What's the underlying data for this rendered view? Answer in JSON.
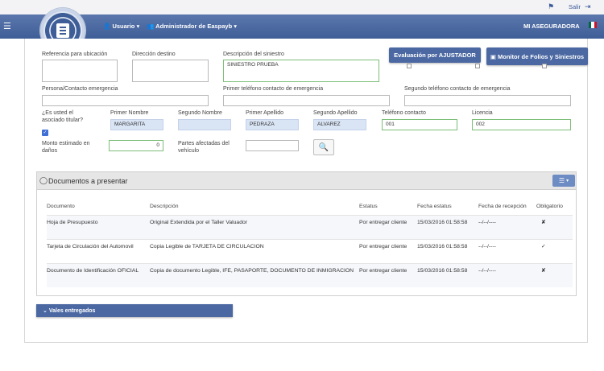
{
  "topbar": {
    "help_icon": "signpost-icon",
    "salir": "Salir",
    "logout_icon": "sign-out-icon"
  },
  "navbar": {
    "menu_icon": "hamburger-menu-icon",
    "usuario": "Usuario",
    "administrador": "Administrador de Easpayb",
    "aseguradora": "MI ASEGURADORA",
    "flag_colors": [
      "#006847",
      "#ffffff",
      "#ce1126"
    ]
  },
  "form": {
    "referencia_label": "Referencia para ubicación",
    "direccion_label": "Dirección destino",
    "descripcion_label": "Descripción del siniestro",
    "descripcion_value": "SINIESTRO PRUEBA",
    "btn_evaluacion": "Evaluación por AJUSTADOR",
    "btn_monitor": "Monitor de Folios y Siniestros",
    "persona_label": "Persona/Contacto emergencia",
    "primer_tel_label": "Primer teléfono contacto de emergencia",
    "segundo_tel_label": "Segundo teléfono contacto de emergencia",
    "titular_label": "¿Es usted el asociado titular?",
    "primer_nombre_label": "Primer Nombre",
    "primer_nombre_value": "MARGARITA",
    "segundo_nombre_label": "Segundo Nombre",
    "segundo_nombre_value": "",
    "primer_apellido_label": "Primer Apellido",
    "primer_apellido_value": "PEDRAZA",
    "segundo_apellido_label": "Segundo Apellido",
    "segundo_apellido_value": "ALVAREZ",
    "telefono_label": "Teléfono contacto",
    "telefono_value": "001",
    "licencia_label": "Licencia",
    "licencia_value": "002",
    "monto_label": "Monto estimado en daños",
    "monto_value": "0",
    "partes_label": "Partes afectadas del vehículo",
    "partes_value": ""
  },
  "documentos": {
    "title": "Documentos a presentar",
    "headers": [
      "Documento",
      "Descripción",
      "Estatus",
      "Fecha estatus",
      "Fecha de recepción",
      "Obligatorio"
    ],
    "rows": [
      {
        "documento": "Hoja de Presupuesto",
        "descripcion": "Original Extendida por el Taller Valuador",
        "estatus": "Por entregar cliente",
        "fecha_estatus": "15/03/2016 01:58:58",
        "fecha_recepcion": "--/--/----",
        "obligatorio": "✘"
      },
      {
        "documento": "Tarjeta de Circulación del Automovil",
        "descripcion": "Copia Legible de TARJETA DE CIRCULACION",
        "estatus": "Por entregar cliente",
        "fecha_estatus": "15/03/2016 01:58:58",
        "fecha_recepcion": "--/--/----",
        "obligatorio": "✓"
      },
      {
        "documento": "Documento de Identificación OFICIAL",
        "descripcion": "Copia de documento Legible, IFE, PASAPORTE, DOCUMENTO DE INMIGRACION",
        "estatus": "Por entregar cliente",
        "fecha_estatus": "15/03/2016 01:58:58",
        "fecha_recepcion": "--/--/----",
        "obligatorio": "✘"
      }
    ]
  },
  "vales": {
    "label": "Vales entregados"
  }
}
